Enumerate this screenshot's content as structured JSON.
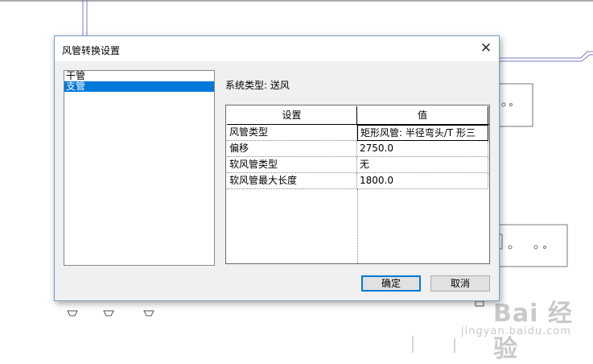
{
  "dialog": {
    "title": "风管转换设置",
    "close_glyph": "✕",
    "list_items": [
      {
        "label": "干管",
        "selected": false
      },
      {
        "label": "支管",
        "selected": true
      }
    ],
    "system_type_text": "系统类型: 送风",
    "grid": {
      "headers": [
        "设置",
        "值"
      ],
      "rows": [
        {
          "name": "风管类型",
          "value": "矩形风管: 半径弯头/T 形三"
        },
        {
          "name": "偏移",
          "value": "2750.0"
        },
        {
          "name": "软风管类型",
          "value": "无"
        },
        {
          "name": "软风管最大长度",
          "value": "1800.0"
        }
      ]
    },
    "ok_label": "确定",
    "cancel_label": "取消"
  },
  "watermark": {
    "main": "Bai 经验",
    "sub": "jingyan.baidu.com"
  },
  "colors": {
    "selection": "#0078d7",
    "cad_lines": "#7b7bd0"
  }
}
